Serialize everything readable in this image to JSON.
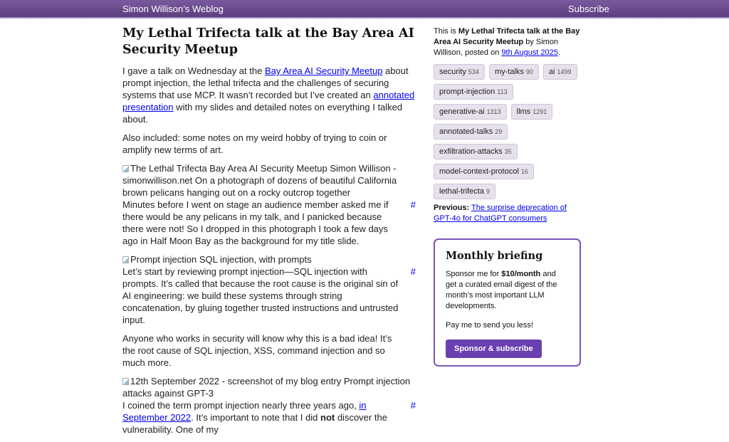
{
  "header": {
    "site_title": "Simon Willison’s Weblog",
    "subscribe": "Subscribe"
  },
  "post": {
    "title": "My Lethal Trifecta talk at the Bay Area AI Security Meetup",
    "p1": {
      "before": "I gave a talk on Wednesday at the ",
      "link1": "Bay Area AI Security Meetup",
      "middle": " about prompt injection, the lethal trifecta and the challenges of securing systems that use MCP. It wasn’t recorded but I’ve created an ",
      "link2": "annotated presentation",
      "after": " with my slides and detailed notes on everything I talked about."
    },
    "p2": "Also included: some notes on my weird hobby of trying to coin or amplify new terms of art.",
    "slides": [
      {
        "alt": "The Lethal Trifecta Bay Area AI Security Meetup Simon Willison - simonwillison.net On a photograph of dozens of beautiful California brown pelicans hanging out on a rocky outcrop together",
        "text": "Minutes before I went on stage an audience member asked me if there would be any pelicans in my talk, and I panicked because there were not! So I dropped in this photograph I took a few days ago in Half Moon Bay as the background for my title slide.",
        "anchor": "#"
      },
      {
        "alt": "Prompt injection SQL injection, with prompts",
        "text": "Let’s start by reviewing prompt injection—SQL injection with prompts. It’s called that because the root cause is the original sin of AI engineering: we build these systems through string concatenation, by gluing together trusted instructions and untrusted input.",
        "extra": "Anyone who works in security will know why this is a bad idea! It’s the root cause of SQL injection, XSS, command injection and so much more.",
        "anchor": "#"
      },
      {
        "alt": "12th September 2022 - screenshot of my blog entry Prompt injection attacks against GPT-3",
        "text_before": "I coined the term prompt injection nearly three years ago, ",
        "link": "in September 2022",
        "text_middle": ". It’s important to note that I did ",
        "bold": "not",
        "text_after": " discover the vulnerability. One of my",
        "anchor": "#"
      }
    ]
  },
  "sidebar": {
    "intro_prefix": "This is ",
    "intro_title": "My Lethal Trifecta talk at the Bay Area AI Security Meetup",
    "intro_by": " by Simon Willison, posted on ",
    "intro_date": "9th August 2025",
    "intro_end": ".",
    "tags": [
      {
        "name": "security",
        "count": "534"
      },
      {
        "name": "my-talks",
        "count": "90"
      },
      {
        "name": "ai",
        "count": "1499"
      },
      {
        "name": "prompt-injection",
        "count": "113"
      },
      {
        "name": "generative-ai",
        "count": "1313"
      },
      {
        "name": "llms",
        "count": "1291"
      },
      {
        "name": "annotated-talks",
        "count": "29"
      },
      {
        "name": "exfiltration-attacks",
        "count": "35"
      },
      {
        "name": "model-context-protocol",
        "count": "16"
      },
      {
        "name": "lethal-trifecta",
        "count": "9"
      }
    ],
    "previous_label": "Previous:",
    "previous_link": "The surprise deprecation of GPT-4o for ChatGPT consumers"
  },
  "briefing": {
    "title": "Monthly briefing",
    "text_before": "Sponsor me for ",
    "price": "$10/month",
    "text_after": " and get a curated email digest of the month’s most important LLM developments.",
    "pay": "Pay me to send you less!",
    "button": "Sponsor & subscribe"
  },
  "colors": {
    "header_bg": "#6b4d91",
    "accent": "#6a3fb0",
    "tag_bg": "#e6e1ec",
    "link": "#0000ee"
  }
}
